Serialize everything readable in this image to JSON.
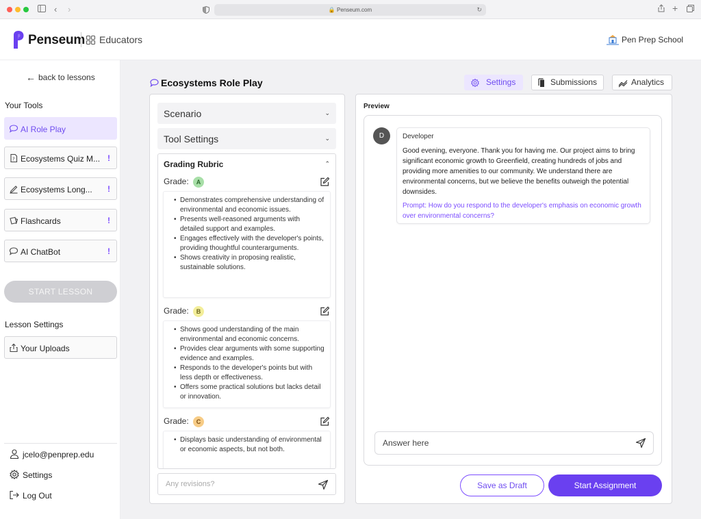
{
  "colors": {
    "accent": "#6a40f0",
    "accent_light": "#ece6ff",
    "warning": "#7c4dff",
    "grade_a": "#a8dfa8",
    "grade_b": "#f3ee9a",
    "grade_c": "#f7cc86"
  },
  "browser": {
    "url": "Penseum.com"
  },
  "header": {
    "brand": "Penseum",
    "section": "Educators",
    "school": "Pen Prep School"
  },
  "sidebar": {
    "back_label": "back to lessons",
    "tools_heading": "Your Tools",
    "tools": [
      {
        "label": "AI Role Play",
        "icon": "chat-bubble-icon",
        "active": true,
        "warning": ""
      },
      {
        "label": "Ecosystems Quiz M...",
        "icon": "quiz-icon",
        "active": false,
        "warning": "!"
      },
      {
        "label": "Ecosystems Long...",
        "icon": "pen-icon",
        "active": false,
        "warning": "!"
      },
      {
        "label": "Flashcards",
        "icon": "cards-icon",
        "active": false,
        "warning": "!"
      },
      {
        "label": "AI ChatBot",
        "icon": "chat-bubble-icon",
        "active": false,
        "warning": "!"
      }
    ],
    "start_lesson": "START LESSON",
    "lesson_settings_heading": "Lesson Settings",
    "uploads_label": "Your Uploads",
    "footer": {
      "email": "jcelo@penprep.edu",
      "settings": "Settings",
      "logout": "Log Out"
    }
  },
  "main": {
    "title": "Ecosystems Role Play",
    "tabs": [
      {
        "label": "Settings",
        "icon": "gear-icon",
        "active": true
      },
      {
        "label": "Submissions",
        "icon": "document-icon",
        "active": false
      },
      {
        "label": "Analytics",
        "icon": "trend-icon",
        "active": false
      }
    ]
  },
  "editor": {
    "scenario_label": "Scenario",
    "tool_settings_label": "Tool Settings",
    "rubric": {
      "heading": "Grading Rubric",
      "grade_label": "Grade:",
      "grades": [
        {
          "letter": "A",
          "criteria": [
            "Demonstrates comprehensive understanding of environmental and economic issues.",
            "Presents well-reasoned arguments with detailed support and examples.",
            "Engages effectively with the developer's points, providing thoughtful counterarguments.",
            "Shows creativity in proposing realistic, sustainable solutions."
          ]
        },
        {
          "letter": "B",
          "criteria": [
            "Shows good understanding of the main environmental and economic concerns.",
            "Provides clear arguments with some supporting evidence and examples.",
            "Responds to the developer's points but with less depth or effectiveness.",
            "Offers some practical solutions but lacks detail or innovation."
          ]
        },
        {
          "letter": "C",
          "criteria": [
            "Displays basic understanding of environmental or economic aspects, but not both."
          ]
        }
      ]
    },
    "revisions_placeholder": "Any revisions?"
  },
  "preview": {
    "label": "Preview",
    "avatar_initial": "D",
    "speaker": "Developer",
    "message": "Good evening, everyone. Thank you for having me. Our project aims to bring significant economic growth to Greenfield, creating hundreds of jobs and providing more amenities to our community. We understand there are environmental concerns, but we believe the benefits outweigh the potential downsides.",
    "prompt": "Prompt: How do you respond to the developer's emphasis on economic growth over environmental concerns?",
    "answer_placeholder": "Answer here"
  },
  "actions": {
    "save_draft": "Save as Draft",
    "start_assignment": "Start Assignment"
  }
}
